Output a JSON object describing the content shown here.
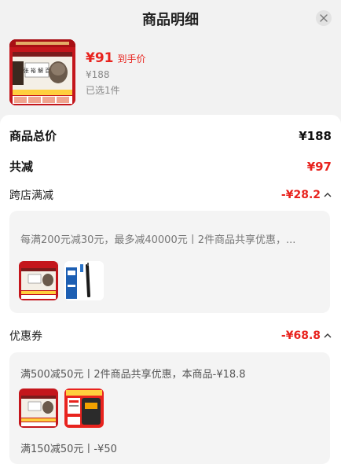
{
  "header": {
    "title": "商品明细"
  },
  "product": {
    "price_now": "¥91",
    "price_tag": "到手价",
    "price_orig": "¥188",
    "selected": "已选1件"
  },
  "summary": {
    "total_label": "商品总价",
    "total_value": "¥188",
    "reduce_label": "共减",
    "reduce_value": "¥97"
  },
  "cross_store": {
    "label": "跨店满减",
    "value": "-¥28.2",
    "description": "每满200元减30元，最多减40000元丨2件商品共享优惠，..."
  },
  "coupons": {
    "label": "优惠券",
    "value": "-¥68.8",
    "coupon1": "满500减50元丨2件商品共享优惠，本商品-¥18.8",
    "coupon2": "满150减50元丨-¥50"
  },
  "colors": {
    "accent": "#e8231e",
    "background": "#f2f2f2"
  }
}
